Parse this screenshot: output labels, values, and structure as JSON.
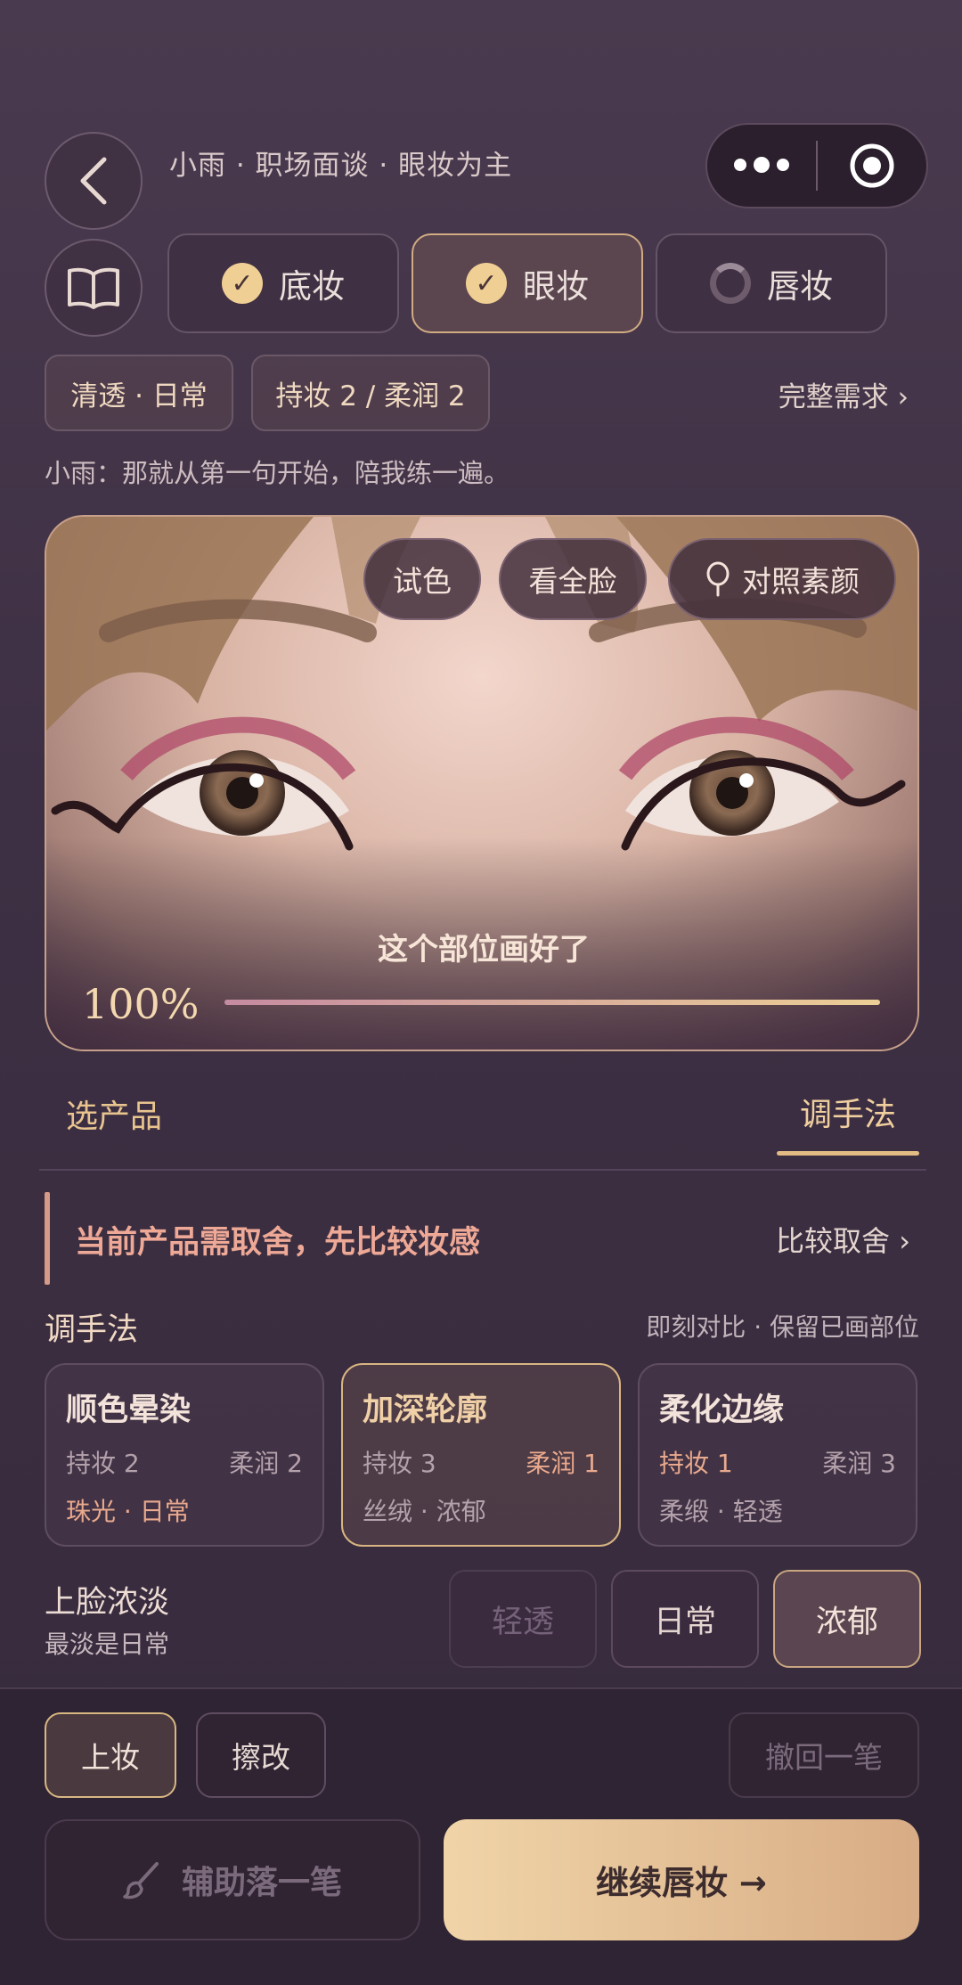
{
  "header": {
    "context": "小雨 · 职场面谈 · 眼妆为主",
    "back_icon": "chevron-left-icon",
    "guide_icon": "open-book-icon",
    "menu_icon": "more-dots-icon",
    "close_icon": "target-circle-icon"
  },
  "stages": [
    {
      "label": "底妆",
      "state": "done"
    },
    {
      "label": "眼妆",
      "state": "done-active"
    },
    {
      "label": "唇妆",
      "state": "in-progress"
    }
  ],
  "chips": {
    "style": "清透 · 日常",
    "metrics": "持妆 2 / 柔润 2",
    "full_request": "完整需求 ›"
  },
  "dialogue": "小雨：那就从第一句开始，陪我练一遍。",
  "preview": {
    "actions": {
      "try_color": "试色",
      "full_face": "看全脸",
      "compare_bare": "对照素颜"
    },
    "status_text": "这个部位画好了",
    "progress_label": "100%",
    "progress_value": 100
  },
  "section_tabs": {
    "products": "选产品",
    "technique": "调手法"
  },
  "notice": {
    "text": "当前产品需取舍，先比较妆感",
    "link": "比较取舍 ›"
  },
  "technique": {
    "title": "调手法",
    "hint": "即刻对比 · 保留已画部位",
    "cards": [
      {
        "title": "顺色晕染",
        "wear": "持妆 2",
        "soft": "柔润 2",
        "tags": "珠光 · 日常"
      },
      {
        "title": "加深轮廓",
        "wear": "持妆 3",
        "soft": "柔润 1",
        "tags": "丝绒 · 浓郁"
      },
      {
        "title": "柔化边缘",
        "wear": "持妆 1",
        "soft": "柔润 3",
        "tags": "柔缎 · 轻透"
      }
    ]
  },
  "intensity": {
    "title": "上脸浓淡",
    "subtitle": "最淡是日常",
    "options": [
      "轻透",
      "日常",
      "浓郁"
    ]
  },
  "tools": {
    "apply": "上妆",
    "erase": "擦改",
    "undo": "撤回一笔",
    "assist": "辅助落一笔",
    "assist_icon": "brush-icon",
    "next": "继续唇妆 →"
  },
  "colors": {
    "accent": "#d9b781",
    "highlight": "#e9a98d",
    "button_gold": "#e8c59d"
  }
}
